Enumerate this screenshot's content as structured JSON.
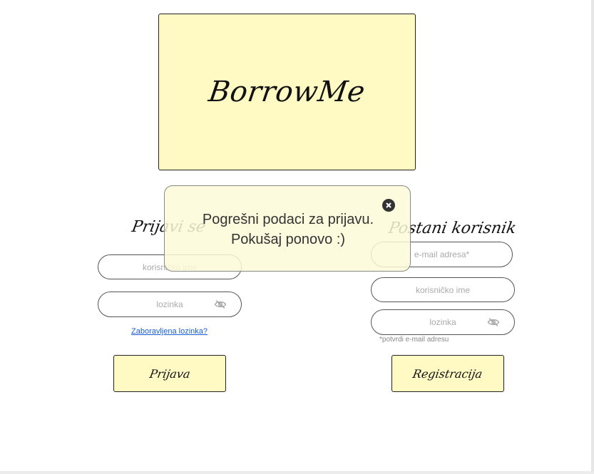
{
  "app": {
    "logo_text": "BorrowMe"
  },
  "login": {
    "title": "Prijavi se",
    "username_placeholder": "korisničko ime",
    "password_placeholder": "lozinka",
    "forgot_password": "Zaboravljena lozinka?",
    "submit_label": "Prijava"
  },
  "register": {
    "title": "Postani korisnik",
    "email_placeholder": "e-mail adresa*",
    "username_placeholder": "korisničko ime",
    "password_placeholder": "lozinka",
    "hint": "*potvrdi e-mail adresu",
    "submit_label": "Registracija"
  },
  "toast": {
    "line1": "Pogrešni podaci za prijavu.",
    "line2": "Pokušaj ponovo :)"
  },
  "icons": {
    "password_visibility": "eye-off-icon",
    "close": "close-icon"
  },
  "colors": {
    "accent_yellow": "#fff9c4",
    "link_blue": "#1a5fd6"
  }
}
